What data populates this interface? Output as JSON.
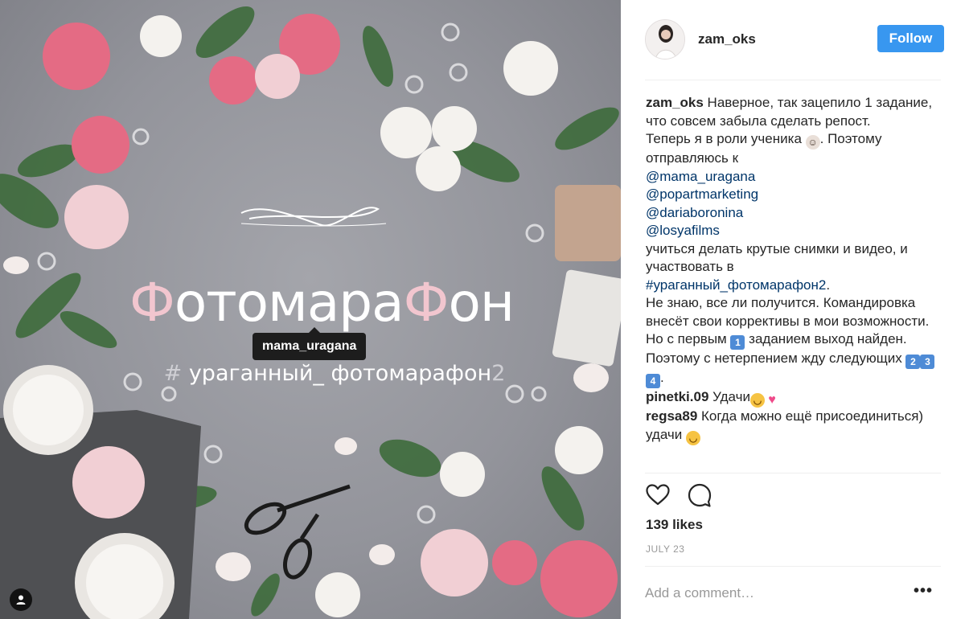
{
  "photo": {
    "title_pink_1": "Ф",
    "title_middle": "отомара",
    "title_pink_2": "Ф",
    "title_end": "он",
    "hashtag_sign": "#",
    "hashtag_text": " ураганный_ фотомарафон",
    "hashtag_num": "2",
    "tagged_user": "mama_uragana",
    "accent_pink": "#f2c6cf"
  },
  "header": {
    "username": "zam_oks",
    "follow_label": "Follow"
  },
  "caption": {
    "user": "zam_oks",
    "line1": " Наверное, так зацепило 1 задание, что совсем забыла сделать репост.",
    "line2": "Теперь я в роли ученика ",
    "line2_end": ". Поэтому отправляюсь к",
    "mentions": [
      "@mama_uragana",
      "@popartmarketing",
      "@dariaboronina",
      "@losyafilms"
    ],
    "line3": "учиться делать крутые снимки и видео, и участвовать в",
    "hashtag": "#ураганный_фотомарафон2",
    "hashtag_end": ".",
    "line4": "Не знаю, все ли получится. Командировка внесёт свои коррективы в мои возможности. Но с первым ",
    "key1": "1",
    "line5": " заданием выход найден. Поэтому с нетерпением жду следующих ",
    "key2": "2",
    "key3": "3",
    "key4": "4",
    "line5_end": "."
  },
  "comments": [
    {
      "user": "pinetki.09",
      "text": " Удачи"
    },
    {
      "user": "regsa89",
      "text": " Когда можно ещё присоединиться) удачи "
    }
  ],
  "likes_text": "139 likes",
  "date_text": "JULY 23",
  "comment_placeholder": "Add a comment…",
  "more_label": "•••",
  "icons": {
    "like": "heart-icon",
    "comment": "comment-icon",
    "tag": "user-tag-icon"
  },
  "colors": {
    "follow_button": "#3897f0",
    "link": "#003569",
    "muted": "#999999"
  }
}
